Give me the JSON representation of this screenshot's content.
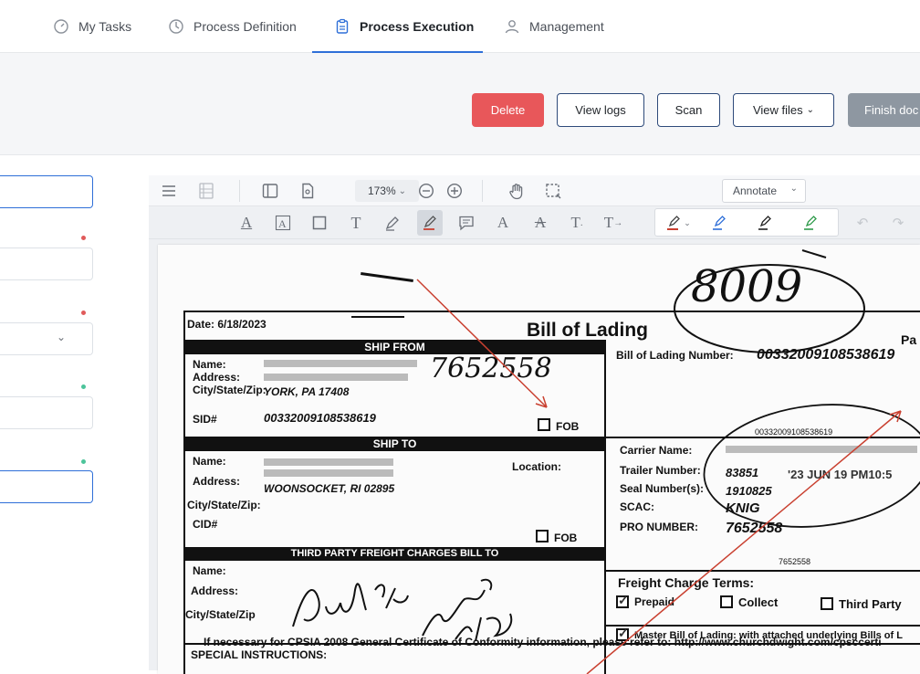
{
  "nav": {
    "tabs": [
      {
        "label": "My Tasks",
        "icon": "gauge-icon"
      },
      {
        "label": "Process Definition",
        "icon": "clock-icon"
      },
      {
        "label": "Process Execution",
        "icon": "clipboard-icon"
      },
      {
        "label": "Management",
        "icon": "user-icon"
      }
    ],
    "active_index": 2
  },
  "actions": {
    "delete": "Delete",
    "view_logs": "View logs",
    "scan": "Scan",
    "view_files": "View files",
    "finish": "Finish doc"
  },
  "viewer": {
    "zoom": "173%",
    "annotate_mode": "Annotate"
  },
  "document": {
    "date": "Date: 6/18/2023",
    "title": "Bill of Lading",
    "page_label": "Pa",
    "ship_from_header": "SHIP FROM",
    "ship_to_header": "SHIP TO",
    "third_party_header": "THIRD PARTY FREIGHT CHARGES BILL TO",
    "label_name": "Name:",
    "label_address": "Address:",
    "label_city": "City/State/Zip:",
    "label_city_short": "City/State/Zip",
    "label_sid": "SID#",
    "label_cid": "CID#",
    "label_location": "Location:",
    "label_fob": "FOB",
    "ship_from_city": "YORK, PA 17408",
    "sid_number": "00332009108538619",
    "ship_to_city": "WOONSOCKET, RI 02895",
    "bol_label": "Bill of Lading Number:",
    "bol_number": "00332009108538619",
    "carrier_name": "Carrier Name:",
    "trailer_number": "Trailer Number:",
    "trailer_value": "83851",
    "seal_numbers": "Seal Number(s):",
    "seal_value": "1910825",
    "scac": "SCAC:",
    "scac_value": "KNIG",
    "pro_number": "PRO NUMBER:",
    "pro_value": "7652558",
    "small_number": "00332009108538619",
    "small_pro": "7652558",
    "freight_terms": "Freight Charge Terms:",
    "prepaid": "Prepaid",
    "collect": "Collect",
    "third_party": "Third Party",
    "master_bol": "Master Bill of Lading: with attached underlying Bills of L",
    "cpsia": "If necessary for CPSIA 2008 General Certificate of Conformity information, please refer to: http://www.churchdwight.com/cpsccerti",
    "special": "SPECIAL INSTRUCTIONS:",
    "stamp": "'23 JUN 19 PM10:5",
    "hw_number": "8009",
    "hw_pro": "7652558"
  },
  "colors": {
    "accent": "#2e6fd8",
    "danger": "#e8575a",
    "required_dot": "#e05a5a",
    "ok_dot": "#4cc49a",
    "annotation_arrow": "#c94030"
  }
}
